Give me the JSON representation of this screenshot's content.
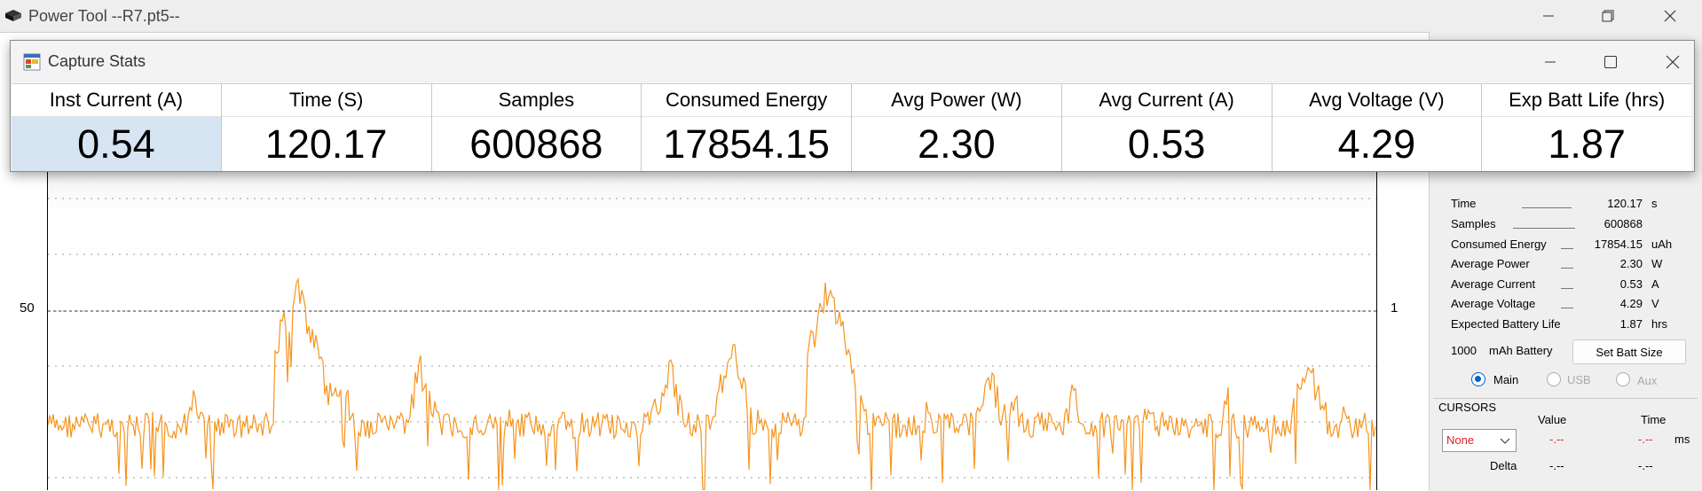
{
  "main_window": {
    "title": "Power Tool --R7.pt5--",
    "controls": [
      "minimize-icon",
      "restore-icon",
      "close-icon"
    ]
  },
  "stats_window": {
    "title": "Capture Stats",
    "columns": [
      {
        "label": "Inst Current (A)",
        "value": "0.54"
      },
      {
        "label": "Time (S)",
        "value": "120.17"
      },
      {
        "label": "Samples",
        "value": "600868"
      },
      {
        "label": "Consumed Energy",
        "value": "17854.15"
      },
      {
        "label": "Avg Power (W)",
        "value": "2.30"
      },
      {
        "label": "Avg Current (A)",
        "value": "0.53"
      },
      {
        "label": "Avg Voltage (V)",
        "value": "4.29"
      },
      {
        "label": "Exp Batt Life (hrs)",
        "value": "1.87"
      }
    ],
    "selected_column": 0
  },
  "plot": {
    "left_axis_label": "50",
    "right_axis_label": "1",
    "trace_color": "#f7941d"
  },
  "capture_stats_panel": {
    "rows": [
      {
        "label": "Time",
        "value": "120.17",
        "unit": "s"
      },
      {
        "label": "Samples",
        "value": "600868",
        "unit": ""
      },
      {
        "label": "Consumed Energy",
        "value": "17854.15",
        "unit": "uAh"
      },
      {
        "label": "Average Power",
        "value": "2.30",
        "unit": "W"
      },
      {
        "label": "Average Current",
        "value": "0.53",
        "unit": "A"
      },
      {
        "label": "Average Voltage",
        "value": "4.29",
        "unit": "V"
      },
      {
        "label": "Expected Battery Life",
        "value": "1.87",
        "unit": "hrs"
      }
    ],
    "battery_size": "1000",
    "battery_unit": "mAh Battery",
    "set_batt_button": "Set Batt Size",
    "channels": [
      {
        "label": "Main",
        "selected": true
      },
      {
        "label": "USB",
        "selected": false
      },
      {
        "label": "Aux",
        "selected": false
      }
    ]
  },
  "cursors": {
    "title": "CURSORS",
    "value_header": "Value",
    "time_header": "Time",
    "dropdown_value": "None",
    "cursor_value": "-.--",
    "cursor_time": "-.--",
    "time_unit": "ms",
    "delta_label": "Delta",
    "delta_value": "-.--",
    "delta_time": "-.--"
  }
}
